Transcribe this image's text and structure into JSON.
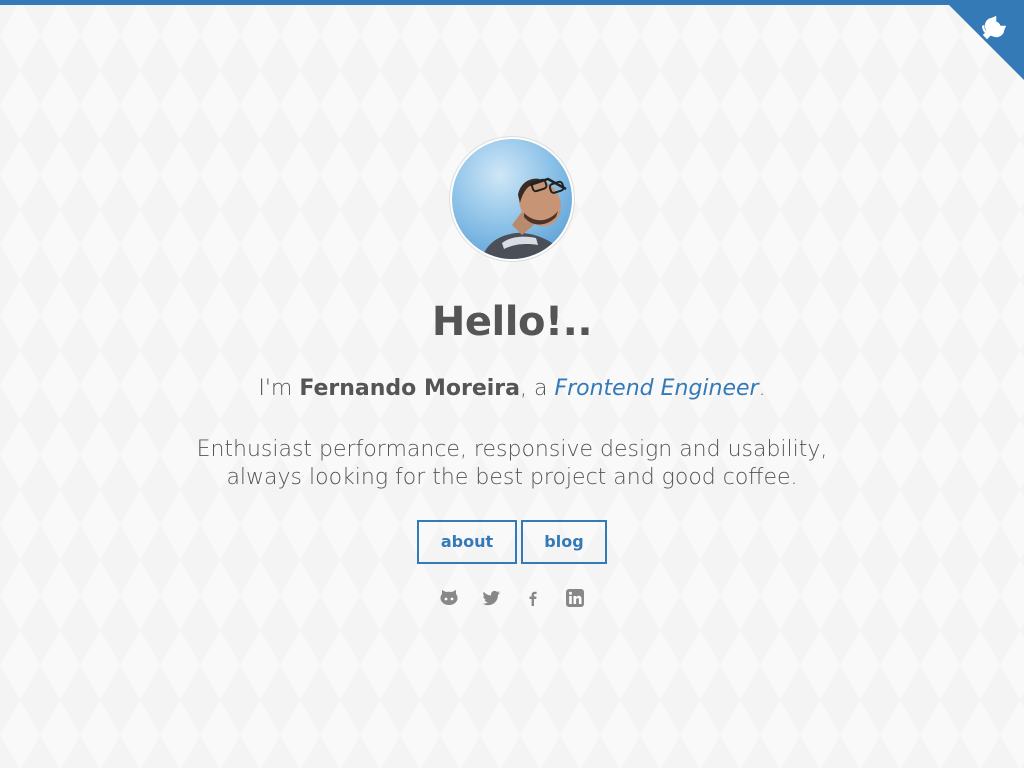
{
  "corner": {
    "icon": "octocat-icon",
    "color": "#337ab7"
  },
  "profile": {
    "greeting": "Hello!..",
    "intro_prefix": "I'm ",
    "name": "Fernando Moreira",
    "intro_middle": ", a ",
    "role": "Frontend Engineer",
    "intro_suffix": ".",
    "bio": "Enthusiast performance, responsive design and usability, always looking for the best project and good coffee."
  },
  "nav": {
    "about_label": "about",
    "blog_label": "blog"
  },
  "social": [
    {
      "icon": "github-icon"
    },
    {
      "icon": "twitter-icon"
    },
    {
      "icon": "facebook-icon"
    },
    {
      "icon": "linkedin-icon"
    }
  ],
  "colors": {
    "accent": "#337ab7",
    "text": "#555555",
    "icon": "#888888",
    "background": "#f9f9f9"
  }
}
